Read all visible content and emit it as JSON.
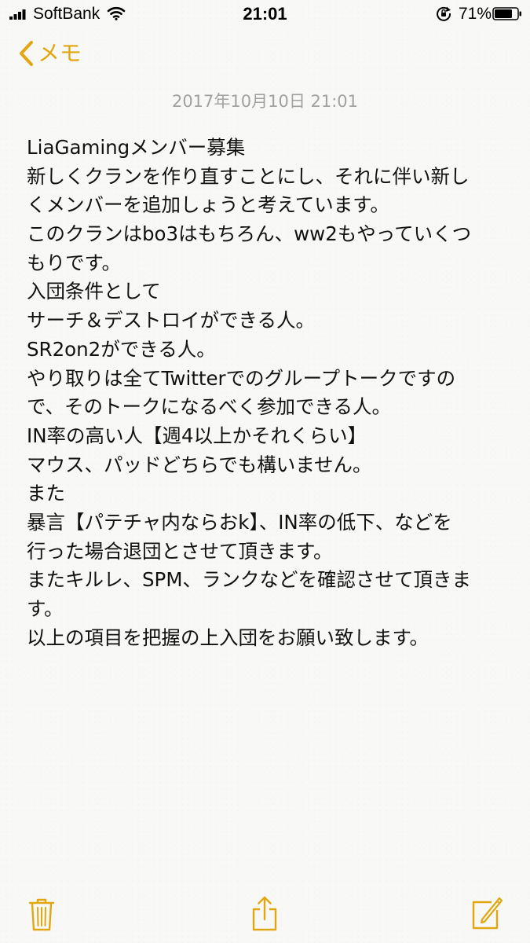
{
  "status_bar": {
    "carrier": "SoftBank",
    "time": "21:01",
    "battery_percent": "71%"
  },
  "nav": {
    "back_label": "メモ"
  },
  "note": {
    "timestamp": "2017年10月10日 21:01",
    "lines": [
      "LiaGamingメンバー募集",
      "新しくクランを作り直すことにし、それに伴い新し",
      "くメンバーを追加しょうと考えています。",
      "このクランはbo3はもちろん、ww2もやっていくつ",
      "もりです。",
      "入団条件として",
      "サーチ＆デストロイができる人。",
      "SR2on2ができる人。",
      "やり取りは全てTwitterでのグループトークですの",
      "で、そのトークになるべく参加できる人。",
      "IN率の高い人【週4以上かそれくらい】",
      "マウス、パッドどちらでも構いません。",
      "また",
      "暴言【パテチャ内ならおk】、IN率の低下、などを",
      "行った場合退団とさせて頂きます。",
      "またキルレ、SPM、ランクなどを確認させて頂きま",
      "す。",
      "以上の項目を把握の上入団をお願い致します。"
    ]
  },
  "colors": {
    "accent": "#e1a712",
    "timestamp": "#a1a1a1",
    "text": "#111111",
    "background": "#f8f8f6"
  },
  "icons": {
    "signal": "signal-bars-icon",
    "wifi": "wifi-icon",
    "rotation_lock": "rotation-lock-icon",
    "battery": "battery-icon",
    "back": "chevron-left-icon",
    "trash": "trash-icon",
    "share": "share-icon",
    "compose": "compose-icon"
  }
}
